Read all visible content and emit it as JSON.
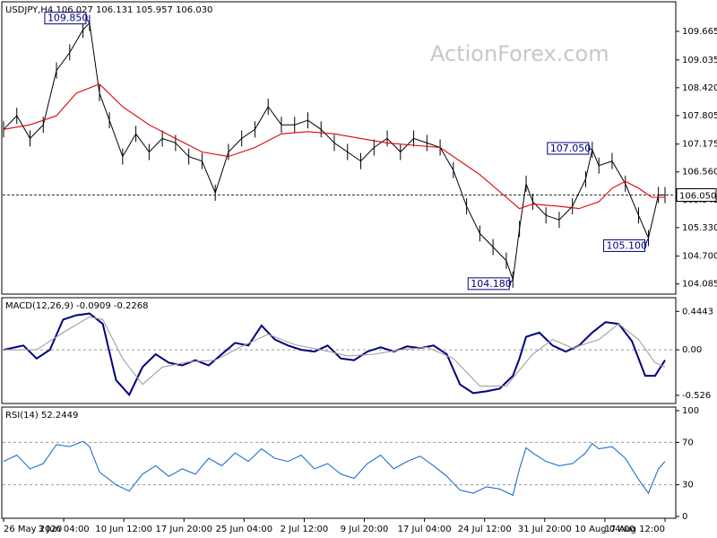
{
  "watermark": "ActionForex.com",
  "chart_data": {
    "type": "line",
    "symbol_header": "USDJPY,H4  106.027 106.131 105.957 106.030",
    "x_ticks": [
      "26 May 2020",
      "3 Jun 04:00",
      "10 Jun 12:00",
      "17 Jun 20:00",
      "25 Jun 04:00",
      "2 Jul 12:00",
      "9 Jul 20:00",
      "17 Jul 04:00",
      "24 Jul 12:00",
      "31 Jul 20:00",
      "10 Aug 04:00",
      "17 Aug 12:00"
    ],
    "price_panel": {
      "ylim": [
        103.9,
        110.2
      ],
      "y_ticks": [
        "109.665",
        "109.035",
        "108.420",
        "107.805",
        "107.175",
        "106.560",
        "105.945",
        "105.330",
        "104.700",
        "104.085"
      ],
      "current_price": "106.050",
      "current_level": 106.05,
      "callouts": [
        {
          "label": "109.850",
          "value": 109.85,
          "t": 0.13
        },
        {
          "label": "104.180",
          "value": 104.18,
          "t": 0.77
        },
        {
          "label": "107.050",
          "value": 107.05,
          "t": 0.89
        },
        {
          "label": "105.100",
          "value": 105.1,
          "t": 0.975
        }
      ],
      "series": [
        {
          "color": "#000000",
          "style": "bars",
          "points": [
            [
              0,
              107.5
            ],
            [
              0.02,
              107.8
            ],
            [
              0.04,
              107.3
            ],
            [
              0.06,
              107.6
            ],
            [
              0.08,
              108.8
            ],
            [
              0.1,
              109.2
            ],
            [
              0.12,
              109.7
            ],
            [
              0.13,
              109.85
            ],
            [
              0.145,
              108.3
            ],
            [
              0.16,
              107.7
            ],
            [
              0.18,
              106.9
            ],
            [
              0.2,
              107.4
            ],
            [
              0.22,
              107.0
            ],
            [
              0.24,
              107.3
            ],
            [
              0.26,
              107.2
            ],
            [
              0.28,
              106.9
            ],
            [
              0.3,
              106.8
            ],
            [
              0.32,
              106.1
            ],
            [
              0.34,
              107.0
            ],
            [
              0.36,
              107.3
            ],
            [
              0.38,
              107.5
            ],
            [
              0.4,
              108.0
            ],
            [
              0.42,
              107.6
            ],
            [
              0.44,
              107.6
            ],
            [
              0.46,
              107.7
            ],
            [
              0.48,
              107.5
            ],
            [
              0.5,
              107.2
            ],
            [
              0.52,
              107.0
            ],
            [
              0.54,
              106.8
            ],
            [
              0.56,
              107.1
            ],
            [
              0.58,
              107.3
            ],
            [
              0.6,
              107.0
            ],
            [
              0.62,
              107.3
            ],
            [
              0.64,
              107.2
            ],
            [
              0.66,
              107.1
            ],
            [
              0.68,
              106.6
            ],
            [
              0.7,
              105.8
            ],
            [
              0.72,
              105.2
            ],
            [
              0.74,
              104.9
            ],
            [
              0.76,
              104.6
            ],
            [
              0.77,
              104.18
            ],
            [
              0.78,
              105.3
            ],
            [
              0.79,
              106.3
            ],
            [
              0.8,
              105.9
            ],
            [
              0.82,
              105.6
            ],
            [
              0.84,
              105.5
            ],
            [
              0.86,
              105.8
            ],
            [
              0.88,
              106.4
            ],
            [
              0.89,
              107.05
            ],
            [
              0.9,
              106.7
            ],
            [
              0.92,
              106.8
            ],
            [
              0.94,
              106.3
            ],
            [
              0.96,
              105.6
            ],
            [
              0.975,
              105.1
            ],
            [
              0.99,
              106.05
            ],
            [
              1.0,
              106.05
            ]
          ]
        },
        {
          "color": "#e00000",
          "style": "line",
          "points": [
            [
              0,
              107.5
            ],
            [
              0.04,
              107.6
            ],
            [
              0.08,
              107.8
            ],
            [
              0.11,
              108.3
            ],
            [
              0.145,
              108.5
            ],
            [
              0.18,
              108.0
            ],
            [
              0.22,
              107.6
            ],
            [
              0.26,
              107.3
            ],
            [
              0.3,
              107.0
            ],
            [
              0.34,
              106.9
            ],
            [
              0.38,
              107.1
            ],
            [
              0.42,
              107.4
            ],
            [
              0.46,
              107.45
            ],
            [
              0.5,
              107.4
            ],
            [
              0.54,
              107.3
            ],
            [
              0.58,
              107.2
            ],
            [
              0.62,
              107.15
            ],
            [
              0.66,
              107.1
            ],
            [
              0.68,
              106.9
            ],
            [
              0.72,
              106.5
            ],
            [
              0.76,
              106.0
            ],
            [
              0.78,
              105.75
            ],
            [
              0.8,
              105.85
            ],
            [
              0.84,
              105.8
            ],
            [
              0.87,
              105.75
            ],
            [
              0.9,
              105.9
            ],
            [
              0.92,
              106.2
            ],
            [
              0.94,
              106.35
            ],
            [
              0.96,
              106.2
            ],
            [
              0.98,
              106.0
            ],
            [
              1.0,
              106.0
            ]
          ]
        }
      ]
    },
    "macd_panel": {
      "title": "MACD(12,26,9) -0.0909 -0.2268",
      "ylim": [
        -0.6,
        0.52
      ],
      "y_ticks": [
        "0.4443",
        "0.00",
        "-0.526"
      ],
      "series": [
        {
          "color": "#000080",
          "style": "line",
          "points": [
            [
              0,
              0.0
            ],
            [
              0.03,
              0.05
            ],
            [
              0.05,
              -0.1
            ],
            [
              0.07,
              0.0
            ],
            [
              0.09,
              0.35
            ],
            [
              0.11,
              0.4
            ],
            [
              0.13,
              0.42
            ],
            [
              0.15,
              0.3
            ],
            [
              0.17,
              -0.35
            ],
            [
              0.19,
              -0.52
            ],
            [
              0.21,
              -0.2
            ],
            [
              0.23,
              -0.05
            ],
            [
              0.25,
              -0.15
            ],
            [
              0.27,
              -0.18
            ],
            [
              0.29,
              -0.12
            ],
            [
              0.31,
              -0.18
            ],
            [
              0.33,
              -0.05
            ],
            [
              0.35,
              0.08
            ],
            [
              0.37,
              0.05
            ],
            [
              0.39,
              0.28
            ],
            [
              0.41,
              0.12
            ],
            [
              0.43,
              0.05
            ],
            [
              0.45,
              0.0
            ],
            [
              0.47,
              -0.02
            ],
            [
              0.49,
              0.05
            ],
            [
              0.51,
              -0.1
            ],
            [
              0.53,
              -0.12
            ],
            [
              0.55,
              -0.02
            ],
            [
              0.57,
              0.03
            ],
            [
              0.59,
              -0.02
            ],
            [
              0.61,
              0.04
            ],
            [
              0.63,
              0.02
            ],
            [
              0.65,
              0.05
            ],
            [
              0.67,
              -0.05
            ],
            [
              0.69,
              -0.4
            ],
            [
              0.71,
              -0.5
            ],
            [
              0.73,
              -0.48
            ],
            [
              0.75,
              -0.45
            ],
            [
              0.77,
              -0.3
            ],
            [
              0.78,
              -0.1
            ],
            [
              0.79,
              0.15
            ],
            [
              0.81,
              0.2
            ],
            [
              0.83,
              0.05
            ],
            [
              0.85,
              -0.02
            ],
            [
              0.87,
              0.05
            ],
            [
              0.89,
              0.2
            ],
            [
              0.91,
              0.32
            ],
            [
              0.93,
              0.3
            ],
            [
              0.95,
              0.1
            ],
            [
              0.97,
              -0.3
            ],
            [
              0.985,
              -0.3
            ],
            [
              1.0,
              -0.12
            ]
          ]
        },
        {
          "color": "#a0a0a0",
          "style": "line",
          "points": [
            [
              0,
              0.0
            ],
            [
              0.05,
              0.0
            ],
            [
              0.09,
              0.2
            ],
            [
              0.13,
              0.38
            ],
            [
              0.15,
              0.35
            ],
            [
              0.18,
              -0.1
            ],
            [
              0.21,
              -0.4
            ],
            [
              0.24,
              -0.2
            ],
            [
              0.28,
              -0.14
            ],
            [
              0.32,
              -0.12
            ],
            [
              0.36,
              0.04
            ],
            [
              0.4,
              0.18
            ],
            [
              0.44,
              0.06
            ],
            [
              0.48,
              0.0
            ],
            [
              0.52,
              -0.07
            ],
            [
              0.56,
              -0.05
            ],
            [
              0.6,
              0.0
            ],
            [
              0.64,
              0.03
            ],
            [
              0.68,
              -0.1
            ],
            [
              0.72,
              -0.42
            ],
            [
              0.76,
              -0.42
            ],
            [
              0.8,
              -0.05
            ],
            [
              0.83,
              0.12
            ],
            [
              0.86,
              0.02
            ],
            [
              0.9,
              0.12
            ],
            [
              0.93,
              0.3
            ],
            [
              0.96,
              0.12
            ],
            [
              0.985,
              -0.15
            ],
            [
              1.0,
              -0.2
            ]
          ]
        }
      ]
    },
    "rsi_panel": {
      "title": "RSI(14) 52.2449",
      "ylim": [
        0,
        100
      ],
      "y_ticks": [
        "100",
        "70",
        "30",
        "0"
      ],
      "series": [
        {
          "color": "#1f6fd0",
          "style": "line",
          "points": [
            [
              0,
              52
            ],
            [
              0.02,
              58
            ],
            [
              0.04,
              45
            ],
            [
              0.06,
              50
            ],
            [
              0.08,
              68
            ],
            [
              0.1,
              66
            ],
            [
              0.12,
              71
            ],
            [
              0.13,
              66
            ],
            [
              0.145,
              42
            ],
            [
              0.17,
              30
            ],
            [
              0.19,
              24
            ],
            [
              0.21,
              40
            ],
            [
              0.23,
              48
            ],
            [
              0.25,
              38
            ],
            [
              0.27,
              45
            ],
            [
              0.29,
              40
            ],
            [
              0.31,
              55
            ],
            [
              0.33,
              48
            ],
            [
              0.35,
              60
            ],
            [
              0.37,
              52
            ],
            [
              0.39,
              64
            ],
            [
              0.41,
              55
            ],
            [
              0.43,
              52
            ],
            [
              0.45,
              58
            ],
            [
              0.47,
              45
            ],
            [
              0.49,
              50
            ],
            [
              0.51,
              40
            ],
            [
              0.53,
              36
            ],
            [
              0.55,
              50
            ],
            [
              0.57,
              58
            ],
            [
              0.59,
              45
            ],
            [
              0.61,
              52
            ],
            [
              0.63,
              57
            ],
            [
              0.65,
              48
            ],
            [
              0.67,
              38
            ],
            [
              0.69,
              25
            ],
            [
              0.71,
              22
            ],
            [
              0.73,
              28
            ],
            [
              0.75,
              26
            ],
            [
              0.77,
              20
            ],
            [
              0.78,
              45
            ],
            [
              0.79,
              65
            ],
            [
              0.8,
              60
            ],
            [
              0.82,
              52
            ],
            [
              0.84,
              48
            ],
            [
              0.86,
              50
            ],
            [
              0.88,
              60
            ],
            [
              0.89,
              69
            ],
            [
              0.9,
              64
            ],
            [
              0.92,
              66
            ],
            [
              0.94,
              55
            ],
            [
              0.96,
              35
            ],
            [
              0.975,
              22
            ],
            [
              0.99,
              45
            ],
            [
              1.0,
              52
            ]
          ]
        }
      ]
    }
  }
}
